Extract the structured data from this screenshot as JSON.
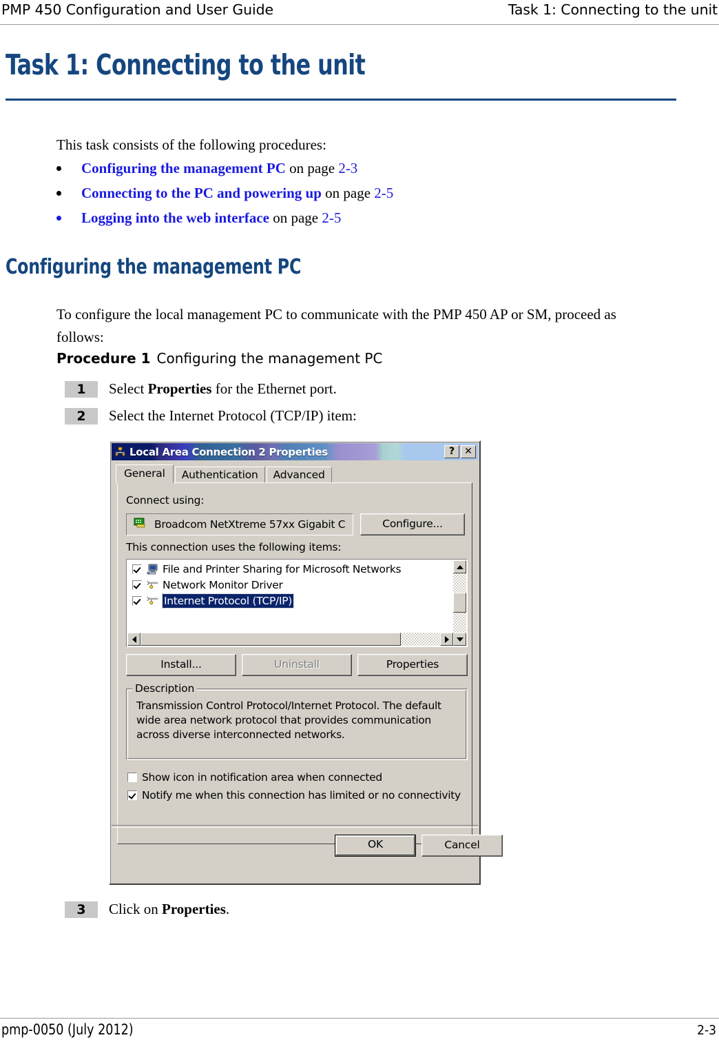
{
  "header": {
    "left": "PMP 450 Configuration and User Guide",
    "right": "Task 1: Connecting to the unit"
  },
  "page_title": "Task 1: Connecting to the unit",
  "intro": "This task consists of the following procedures:",
  "bullets": [
    {
      "link": "Configuring the management PC",
      "mid": " on page ",
      "page": "2-3"
    },
    {
      "link": "Connecting to the PC and powering up",
      "mid": " on page ",
      "page": "2-5"
    },
    {
      "link": "Logging into the web interface",
      "mid": " on page ",
      "page": "2-5"
    }
  ],
  "section_heading": "Configuring the management PC",
  "paragraph": "To configure the local management PC to communicate with the PMP 450 AP or SM, proceed as follows:",
  "procedure": {
    "number_label": "Procedure 1",
    "caption": "Configuring the management PC"
  },
  "steps": [
    {
      "num": "1",
      "pre": "Select ",
      "bold": "Properties",
      "post": " for the Ethernet port."
    },
    {
      "num": "2",
      "pre": "Select the Internet Protocol (TCP/IP) item:",
      "bold": "",
      "post": ""
    },
    {
      "num": "3",
      "pre": "Click on ",
      "bold": "Properties",
      "post": "."
    }
  ],
  "dialog": {
    "title": "Local Area Connection 2 Properties",
    "help_button": "?",
    "close_button": "✕",
    "tabs": [
      {
        "label": "General",
        "active": true
      },
      {
        "label": "Authentication",
        "active": false
      },
      {
        "label": "Advanced",
        "active": false
      }
    ],
    "connect_using_label": "Connect using:",
    "adapter_name": "Broadcom NetXtreme 57xx Gigabit C",
    "configure_button": "Configure...",
    "items_label": "This connection uses the following items:",
    "items": [
      {
        "label": "File and Printer Sharing for Microsoft Networks",
        "checked": true,
        "selected": false,
        "icon": "computer-icon"
      },
      {
        "label": "Network Monitor Driver",
        "checked": true,
        "selected": false,
        "icon": "protocol-icon"
      },
      {
        "label": "Internet Protocol (TCP/IP)",
        "checked": true,
        "selected": true,
        "icon": "protocol-icon"
      }
    ],
    "install_button": "Install...",
    "uninstall_button": "Uninstall",
    "properties_button": "Properties",
    "description_legend": "Description",
    "description_text": "Transmission Control Protocol/Internet Protocol. The default wide area network protocol that provides communication across diverse interconnected networks.",
    "checkboxes": [
      {
        "label": "Show icon in notification area when connected",
        "checked": false
      },
      {
        "label": "Notify me when this connection has limited or no connectivity",
        "checked": true
      }
    ],
    "ok_button": "OK",
    "cancel_button": "Cancel"
  },
  "footer": {
    "left": "pmp-0050 (July 2012)",
    "right": "2-3"
  },
  "colors": {
    "heading_blue": "#15467F",
    "link_blue": "#1a1ae0",
    "dialog_face": "#d4d0c8",
    "selection_blue": "#0a246a",
    "step_badge_gray": "#c8c8c8"
  }
}
